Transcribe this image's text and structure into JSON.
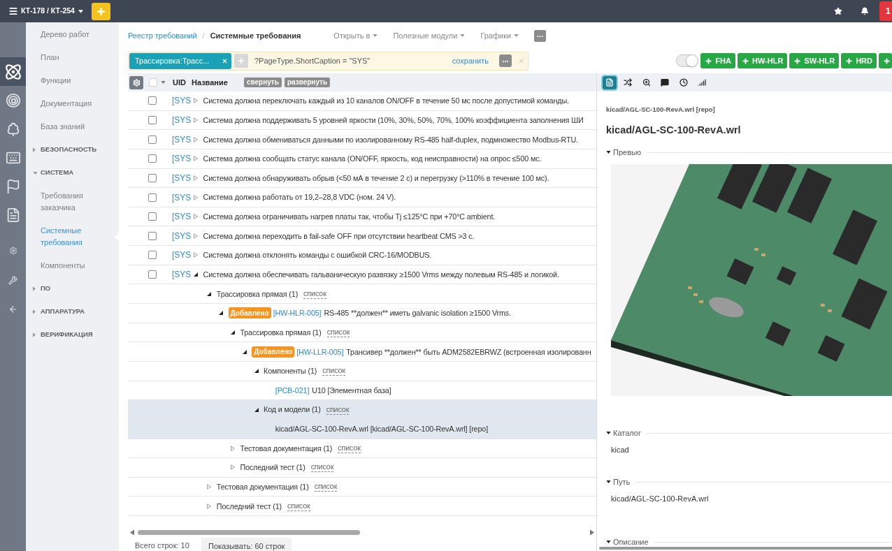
{
  "top_bar": {
    "project": "КТ-178 / КТ-254",
    "notifications": "1"
  },
  "rail": {
    "items": [
      {
        "selected": true
      },
      {
        "selected": false
      },
      {
        "selected": false
      },
      {
        "selected": false
      },
      {
        "selected": false
      },
      {
        "selected": false
      },
      {
        "selected": false
      },
      {
        "selected": false
      },
      {
        "selected": false
      }
    ]
  },
  "nav": {
    "items": [
      {
        "kind": "link",
        "label": "Дерево работ",
        "selected": false
      },
      {
        "kind": "link",
        "label": "План",
        "selected": false
      },
      {
        "kind": "link",
        "label": "Функции",
        "selected": false
      },
      {
        "kind": "link",
        "label": "Документация",
        "selected": false
      },
      {
        "kind": "link",
        "label": "База знаний",
        "selected": false
      },
      {
        "kind": "section",
        "label": "БЕЗОПАСНОСТЬ",
        "expanded": false
      },
      {
        "kind": "section",
        "label": "СИСТЕМА",
        "expanded": true,
        "children": [
          {
            "kind": "link",
            "label": "Требования заказчика",
            "selected": false
          },
          {
            "kind": "link",
            "label": "Системные требования",
            "selected": true
          },
          {
            "kind": "link",
            "label": "Компоненты",
            "selected": false
          }
        ]
      },
      {
        "kind": "section",
        "label": "ПО",
        "expanded": false
      },
      {
        "kind": "section",
        "label": "АППАРАТУРА",
        "expanded": false
      },
      {
        "kind": "section",
        "label": "ВЕРИФИКАЦИЯ",
        "expanded": false
      }
    ]
  },
  "breadcrumb": {
    "items": [
      {
        "kind": "link",
        "label": "Реестр требований"
      },
      {
        "kind": "current",
        "label": "Системные требования"
      }
    ],
    "separator": "/"
  },
  "menus": [
    "Открыть в",
    "Полезные модули",
    "Графики"
  ],
  "more_button": "...",
  "filter": {
    "chip": "Трассировка:Трасс...",
    "query": "?PageType.ShortCaption = \"SYS\"",
    "save_link": "сохранить",
    "more_button": "..."
  },
  "toggle": {
    "on": true
  },
  "create_buttons": [
    {
      "kind": "labeled",
      "label": "FHA"
    },
    {
      "kind": "labeled",
      "label": "HW-HLR"
    },
    {
      "kind": "labeled",
      "label": "SW-HLR"
    },
    {
      "kind": "labeled",
      "label": "HRD"
    },
    {
      "kind": "plain"
    }
  ],
  "table": {
    "select_all_checked": false,
    "columns": [
      "UID",
      "Название"
    ],
    "collapse_button": "свернуть",
    "expand_button": "развернуть",
    "rows": [
      {
        "uid": "[SYS",
        "title": "Система должна переключать каждый из 10 каналов ON/OFF в течение 50 мс после допустимой команды.",
        "checked": false,
        "expanded": false
      },
      {
        "uid": "[SYS",
        "title": "Система должна поддерживать 5 уровней яркости (10%, 30%, 50%, 70%, 100% коэффициента заполнения ШИ",
        "checked": false,
        "expanded": false
      },
      {
        "uid": "[SYS",
        "title": "Система должна обмениваться данными по изолированному RS-485 half-duplex, подмножество Modbus-RTU.",
        "checked": false,
        "expanded": false
      },
      {
        "uid": "[SYS",
        "title": "Система должна сообщать статус канала (ON/OFF, яркость, код неисправности) на опрос ≤500 мс.",
        "checked": false,
        "expanded": false
      },
      {
        "uid": "[SYS",
        "title": "Система должна обнаруживать обрыв (<50 мА в течение 2 с) и перегрузку (>110% в течение 100 мс).",
        "checked": false,
        "expanded": false
      },
      {
        "uid": "[SYS",
        "title": "Система должна работать от 19,2–28,8 VDC (ном. 24 V).",
        "checked": false,
        "expanded": false
      },
      {
        "uid": "[SYS",
        "title": "Система должна ограничивать нагрев платы так, чтобы Tj ≤125°C при +70°C ambient.",
        "checked": false,
        "expanded": false
      },
      {
        "uid": "[SYS",
        "title": "Система должна переходить в fail-safe OFF при отсутствии heartbeat CMS >3 с.",
        "checked": false,
        "expanded": false
      },
      {
        "uid": "[SYS",
        "title": "Система должна отклонять команды с ошибкой CRC-16/MODBUS.",
        "checked": false,
        "expanded": false
      },
      {
        "uid": "[SYS",
        "title": "Система должна обеспечивать гальваническую развязку ≥1500 Vrms между полевым RS-485 и логикой.",
        "checked": false,
        "expanded": true,
        "children": [
          {
            "kind": "group",
            "label": "Трассировка прямая (1)",
            "link": "список",
            "selected": false,
            "expanded": true,
            "children": [
              {
                "kind": "item",
                "badge": "Добавлено",
                "uid": "[HW-HLR-005]",
                "title": "RS-485 **должен** иметь galvanic isolation ≥1500 Vrms.",
                "selected": false,
                "expanded": true,
                "children": [
                  {
                    "kind": "group",
                    "label": "Трассировка прямая (1)",
                    "link": "список",
                    "selected": false,
                    "expanded": true,
                    "children": [
                      {
                        "kind": "item",
                        "badge": "Добавлено",
                        "uid": "[HW-LLR-005]",
                        "title": "Трансивер **должен** быть ADM2582EBRWZ (встроенная изолированн",
                        "selected": false,
                        "expanded": true,
                        "children": [
                          {
                            "kind": "group",
                            "label": "Компоненты (1)",
                            "link": "список",
                            "selected": false,
                            "expanded": true,
                            "children": [
                              {
                                "kind": "item",
                                "uid": "[PCB-021]",
                                "title": "U10 [Элементная база]",
                                "selected": false
                              }
                            ]
                          },
                          {
                            "kind": "group",
                            "label": "Код и модели (1)",
                            "link": "список",
                            "selected": true,
                            "expanded": true,
                            "children": [
                              {
                                "kind": "item",
                                "title": "kicad/AGL-SC-100-RevA.wrl [kicad/AGL-SC-100-RevA.wrl] [repo]",
                                "selected": true
                              }
                            ]
                          }
                        ]
                      }
                    ]
                  },
                  {
                    "kind": "group",
                    "label": "Тестовая документация (1)",
                    "link": "список",
                    "selected": false,
                    "expanded": false
                  },
                  {
                    "kind": "group",
                    "label": "Последний тест (1)",
                    "link": "список",
                    "selected": false,
                    "expanded": false
                  }
                ]
              }
            ]
          },
          {
            "kind": "group",
            "label": "Тестовая документация (1)",
            "link": "список",
            "selected": false,
            "expanded": false
          },
          {
            "kind": "group",
            "label": "Последний тест (1)",
            "link": "список",
            "selected": false,
            "expanded": false
          }
        ]
      }
    ]
  },
  "footer": {
    "total": "Всего строк: 10",
    "page_size": "Показывать: 60 строк"
  },
  "detail": {
    "toolbar": [
      {
        "selected": true
      },
      {
        "selected": false
      },
      {
        "selected": false
      },
      {
        "selected": false
      },
      {
        "selected": false
      },
      {
        "selected": false
      }
    ],
    "subtitle": "kicad/AGL-SC-100-RevA.wrl [repo]",
    "title": "kicad/AGL-SC-100-RevA.wrl",
    "sections": [
      {
        "kind": "preview",
        "label": "Превью",
        "expanded": true
      },
      {
        "kind": "text",
        "label": "Каталог",
        "expanded": true,
        "value": "kicad"
      },
      {
        "kind": "text",
        "label": "Путь",
        "expanded": true,
        "value": "kicad/AGL-SC-100-RevA.wrl"
      },
      {
        "kind": "text",
        "label": "Описание",
        "expanded": true
      }
    ]
  }
}
